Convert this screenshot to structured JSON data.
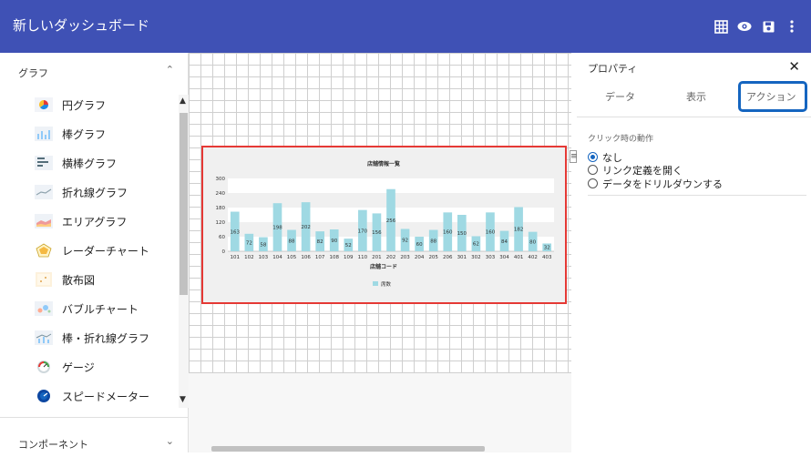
{
  "app": {
    "title": "新しいダッシュボード"
  },
  "toolbar": {
    "icons": [
      "grid-icon",
      "eye-icon",
      "save-icon",
      "more-icon"
    ]
  },
  "left": {
    "graph_section": "グラフ",
    "component_section": "コンポーネント",
    "items": [
      {
        "label": "円グラフ",
        "icon": "pie-chart-icon"
      },
      {
        "label": "棒グラフ",
        "icon": "bar-chart-icon"
      },
      {
        "label": "横棒グラフ",
        "icon": "horizontal-bar-icon"
      },
      {
        "label": "折れ線グラフ",
        "icon": "line-chart-icon"
      },
      {
        "label": "エリアグラフ",
        "icon": "area-chart-icon"
      },
      {
        "label": "レーダーチャート",
        "icon": "radar-chart-icon"
      },
      {
        "label": "散布図",
        "icon": "scatter-icon"
      },
      {
        "label": "バブルチャート",
        "icon": "bubble-chart-icon"
      },
      {
        "label": "棒・折れ線グラフ",
        "icon": "bar-line-icon"
      },
      {
        "label": "ゲージ",
        "icon": "gauge-icon"
      },
      {
        "label": "スピードメーター",
        "icon": "speedometer-icon"
      }
    ]
  },
  "chart_data": {
    "type": "bar",
    "title": "店舗情報一覧",
    "xlabel": "店舗コード",
    "ylabel": "",
    "ylim": [
      0,
      300
    ],
    "yticks": [
      0,
      60,
      120,
      180,
      240,
      300
    ],
    "categories": [
      "101",
      "102",
      "103",
      "104",
      "105",
      "106",
      "107",
      "108",
      "109",
      "110",
      "201",
      "202",
      "203",
      "204",
      "205",
      "206",
      "301",
      "302",
      "303",
      "304",
      "401",
      "402",
      "403"
    ],
    "series": [
      {
        "name": "席数",
        "values": [
          163,
          72,
          58,
          198,
          88,
          202,
          82,
          90,
          52,
          170,
          156,
          256,
          92,
          60,
          88,
          160,
          150,
          62,
          160,
          84,
          182,
          80,
          32
        ]
      }
    ],
    "color": "#9fd9e3",
    "legend": "bottom"
  },
  "properties": {
    "title": "プロパティ",
    "tabs": [
      "データ",
      "表示",
      "アクション"
    ],
    "active_tab": "アクション",
    "section": "クリック時の動作",
    "options": [
      "なし",
      "リンク定義を開く",
      "データをドリルダウンする"
    ],
    "selected": "なし"
  }
}
